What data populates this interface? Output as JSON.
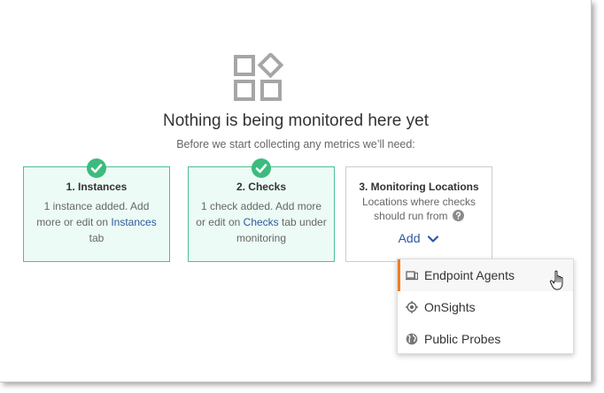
{
  "empty_state": {
    "icon": "widgets-icon",
    "heading": "Nothing is being monitored here yet",
    "subheading": "Before we start collecting any metrics we’ll need:"
  },
  "steps": [
    {
      "title": "1. Instances",
      "status": "complete",
      "desc_before": "1 instance added. Add more or edit on ",
      "link": "Instances",
      "desc_after": " tab"
    },
    {
      "title": "2. Checks",
      "status": "complete",
      "desc_before": "1 check added. Add more or edit on ",
      "link": "Checks",
      "desc_after": " tab under monitoring"
    },
    {
      "title": "3. Monitoring Locations",
      "status": "pending",
      "desc": "Locations where checks should run from",
      "help_icon": "question-circle-icon",
      "add_label": "Add"
    }
  ],
  "dropdown": {
    "items": [
      {
        "label": "Endpoint Agents",
        "icon": "laptop-device-icon",
        "active": true
      },
      {
        "label": "OnSights",
        "icon": "target-icon",
        "active": false
      },
      {
        "label": "Public Probes",
        "icon": "globe-icon",
        "active": false
      }
    ]
  },
  "colors": {
    "success_green": "#3dbb7f",
    "card_done_bg": "#ecfbf5",
    "link_blue": "#2c5aa0",
    "active_accent": "#f07c29"
  }
}
